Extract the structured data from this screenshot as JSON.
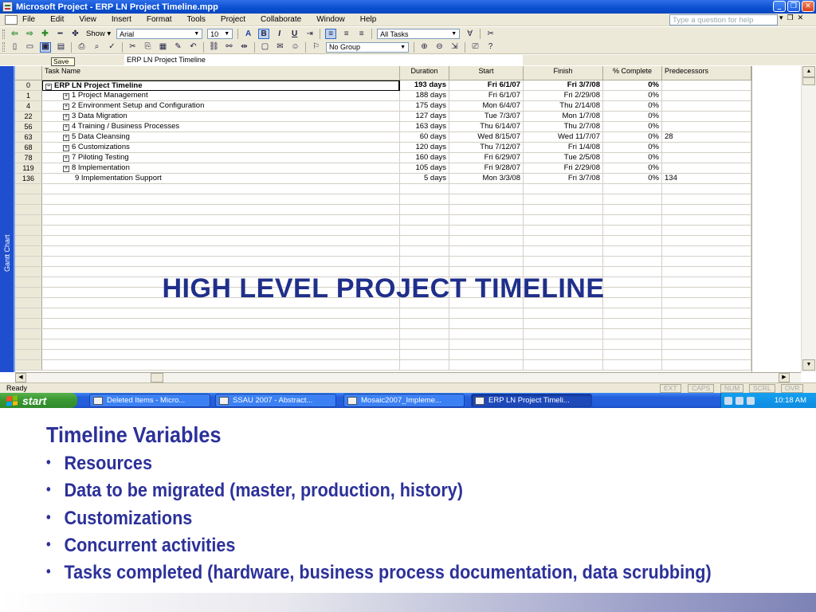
{
  "window": {
    "title": "Microsoft Project - ERP LN Project Timeline.mpp",
    "controls": [
      "_",
      "❐",
      "✕"
    ]
  },
  "menu": {
    "items": [
      "File",
      "Edit",
      "View",
      "Insert",
      "Format",
      "Tools",
      "Project",
      "Collaborate",
      "Window",
      "Help"
    ],
    "help_placeholder": "Type a question for help",
    "doc_controls": [
      "▾",
      "❐",
      "✕"
    ]
  },
  "toolbar": {
    "show_label": "Show ▾",
    "font_name": "Arial",
    "font_size": "10",
    "filter": "All Tasks",
    "group": "No Group"
  },
  "entry_bar": {
    "tooltip": "Save",
    "value": "ERP LN Project  Timeline"
  },
  "view_bar": {
    "label": "Gantt Chart"
  },
  "columns": {
    "task_name": "Task Name",
    "duration": "Duration",
    "start": "Start",
    "finish": "Finish",
    "pct": "% Complete",
    "pred": "Predecessors"
  },
  "rows": [
    {
      "id": "0",
      "name": "ERP LN Project  Timeline",
      "duration": "193 days",
      "start": "Fri 6/1/07",
      "finish": "Fri 3/7/08",
      "pct": "0%",
      "pred": "",
      "bold": true,
      "level": 0,
      "expander": "−"
    },
    {
      "id": "1",
      "name": "1 Project Management",
      "duration": "188 days",
      "start": "Fri 6/1/07",
      "finish": "Fri 2/29/08",
      "pct": "0%",
      "pred": "",
      "bold": false,
      "level": 1,
      "expander": "+"
    },
    {
      "id": "4",
      "name": "2 Environment Setup and Configuration",
      "duration": "175 days",
      "start": "Mon 6/4/07",
      "finish": "Thu 2/14/08",
      "pct": "0%",
      "pred": "",
      "bold": false,
      "level": 1,
      "expander": "+"
    },
    {
      "id": "22",
      "name": "3 Data Migration",
      "duration": "127 days",
      "start": "Tue 7/3/07",
      "finish": "Mon 1/7/08",
      "pct": "0%",
      "pred": "",
      "bold": false,
      "level": 1,
      "expander": "+"
    },
    {
      "id": "56",
      "name": "4 Training / Business Processes",
      "duration": "163 days",
      "start": "Thu 6/14/07",
      "finish": "Thu 2/7/08",
      "pct": "0%",
      "pred": "",
      "bold": false,
      "level": 1,
      "expander": "+"
    },
    {
      "id": "63",
      "name": "5 Data Cleansing",
      "duration": "60 days",
      "start": "Wed 8/15/07",
      "finish": "Wed 11/7/07",
      "pct": "0%",
      "pred": "28",
      "bold": false,
      "level": 1,
      "expander": "+"
    },
    {
      "id": "68",
      "name": "6 Customizations",
      "duration": "120 days",
      "start": "Thu 7/12/07",
      "finish": "Fri 1/4/08",
      "pct": "0%",
      "pred": "",
      "bold": false,
      "level": 1,
      "expander": "+"
    },
    {
      "id": "78",
      "name": "7 Piloting Testing",
      "duration": "160 days",
      "start": "Fri 6/29/07",
      "finish": "Tue 2/5/08",
      "pct": "0%",
      "pred": "",
      "bold": false,
      "level": 1,
      "expander": "+"
    },
    {
      "id": "119",
      "name": "8 Implementation",
      "duration": "105 days",
      "start": "Fri 9/28/07",
      "finish": "Fri 2/29/08",
      "pct": "0%",
      "pred": "",
      "bold": false,
      "level": 1,
      "expander": "+"
    },
    {
      "id": "136",
      "name": "9 Implementation Support",
      "duration": "5 days",
      "start": "Mon 3/3/08",
      "finish": "Fri 3/7/08",
      "pct": "0%",
      "pred": "134",
      "bold": false,
      "level": 1,
      "expander": ""
    }
  ],
  "overlay_title": "HIGH LEVEL PROJECT TIMELINE",
  "status": {
    "text": "Ready",
    "indicators": [
      "EXT",
      "CAPS",
      "NUM",
      "SCRL",
      "OVR"
    ]
  },
  "taskbar": {
    "start_label": "start",
    "buttons": [
      {
        "label": "Deleted Items - Micro...",
        "active": false
      },
      {
        "label": "SSAU 2007 - Abstract...",
        "active": false
      },
      {
        "label": "Mosaic2007_Impleme...",
        "active": false
      },
      {
        "label": "ERP LN Project Timeli...",
        "active": true
      }
    ],
    "clock": "10:18 AM"
  },
  "slide": {
    "heading": "Timeline Variables",
    "bullets": [
      "Resources",
      "Data to be migrated (master, production, history)",
      "Customizations",
      "Concurrent activities",
      "Tasks completed (hardware, business process documentation, data scrubbing)"
    ]
  }
}
